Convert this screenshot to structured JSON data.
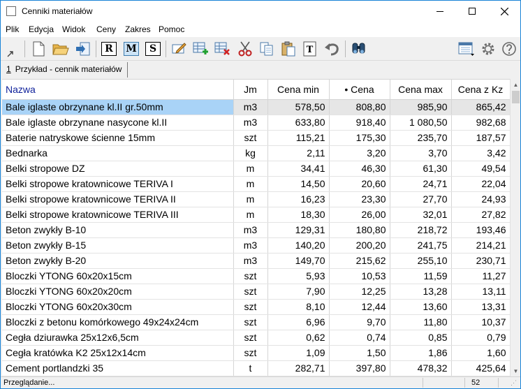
{
  "window": {
    "title": "Cenniki materiałów",
    "icons": {
      "app": "app-window-icon",
      "minimize": "minimize-icon",
      "maximize": "maximize-icon",
      "close": "close-icon"
    }
  },
  "menu": [
    "Plik",
    "Edycja",
    "Widok",
    "Ceny",
    "Zakres",
    "Pomoc"
  ],
  "toolbar": {
    "letters": [
      "R",
      "M",
      "S"
    ],
    "active_letter": "M",
    "icons": [
      "arrow-out-icon",
      "new-document-icon",
      "open-folder-icon",
      "import-icon",
      "edit-icon",
      "add-row-icon",
      "delete-row-icon",
      "cut-icon",
      "copy-icon",
      "paste-icon",
      "text-icon",
      "undo-icon",
      "find-icon",
      "view-options-icon",
      "settings-icon"
    ]
  },
  "tab": {
    "number": "1",
    "label": "Przykład - cennik materiałów"
  },
  "table": {
    "columns": [
      "Nazwa",
      "Jm",
      "Cena min",
      "• Cena",
      "Cena max",
      "Cena z Kz"
    ],
    "rows": [
      [
        "Bale iglaste obrzynane kl.II gr.50mm",
        "m3",
        "578,50",
        "808,80",
        "985,90",
        "865,42"
      ],
      [
        "Bale iglaste obrzynane nasycone kl.II",
        "m3",
        "633,80",
        "918,40",
        "1 080,50",
        "982,68"
      ],
      [
        "Baterie natryskowe ścienne 15mm",
        "szt",
        "115,21",
        "175,30",
        "235,70",
        "187,57"
      ],
      [
        "Bednarka",
        "kg",
        "2,11",
        "3,20",
        "3,70",
        "3,42"
      ],
      [
        "Belki stropowe DZ",
        "m",
        "34,41",
        "46,30",
        "61,30",
        "49,54"
      ],
      [
        "Belki stropowe kratownicowe TERIVA I",
        "m",
        "14,50",
        "20,60",
        "24,71",
        "22,04"
      ],
      [
        "Belki stropowe kratownicowe TERIVA II",
        "m",
        "16,23",
        "23,30",
        "27,70",
        "24,93"
      ],
      [
        "Belki stropowe kratownicowe TERIVA III",
        "m",
        "18,30",
        "26,00",
        "32,01",
        "27,82"
      ],
      [
        "Beton zwykły B-10",
        "m3",
        "129,31",
        "180,80",
        "218,72",
        "193,46"
      ],
      [
        "Beton zwykły B-15",
        "m3",
        "140,20",
        "200,20",
        "241,75",
        "214,21"
      ],
      [
        "Beton zwykły B-20",
        "m3",
        "149,70",
        "215,62",
        "255,10",
        "230,71"
      ],
      [
        "Bloczki YTONG 60x20x15cm",
        "szt",
        "5,93",
        "10,53",
        "11,59",
        "11,27"
      ],
      [
        "Bloczki YTONG 60x20x20cm",
        "szt",
        "7,90",
        "12,25",
        "13,28",
        "13,11"
      ],
      [
        "Bloczki YTONG 60x20x30cm",
        "szt",
        "8,10",
        "12,44",
        "13,60",
        "13,31"
      ],
      [
        "Bloczki z betonu komórkowego 49x24x24cm",
        "szt",
        "6,96",
        "9,70",
        "11,80",
        "10,37"
      ],
      [
        "Cegła dziurawka 25x12x6,5cm",
        "szt",
        "0,62",
        "0,74",
        "0,85",
        "0,79"
      ],
      [
        "Cegła kratówka K2 25x12x14cm",
        "szt",
        "1,09",
        "1,50",
        "1,86",
        "1,60"
      ],
      [
        "Cement portlandzki 35",
        "t",
        "282,71",
        "397,80",
        "478,32",
        "425,64"
      ]
    ],
    "selected_row": 0
  },
  "status": {
    "text": "Przeglądanie...",
    "count": "52"
  },
  "colors": {
    "header_name": "#0d1f9a",
    "selection": "#a9d3f7",
    "window_border": "#1883d7"
  }
}
